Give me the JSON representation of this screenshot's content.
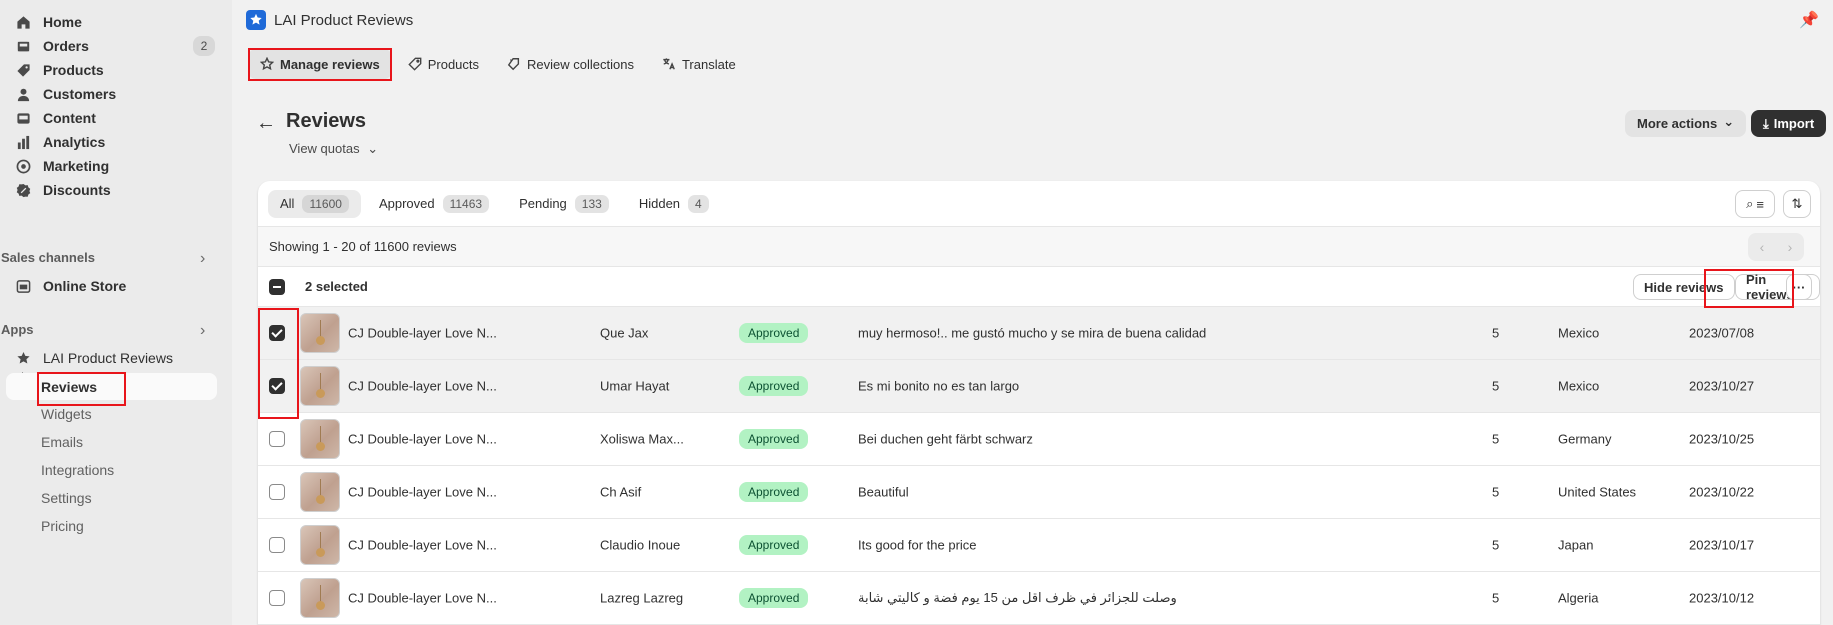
{
  "sidebar": {
    "nav": [
      {
        "label": "Home",
        "icon": "home-icon"
      },
      {
        "label": "Orders",
        "icon": "orders-icon",
        "badge": "2"
      },
      {
        "label": "Products",
        "icon": "tag-icon"
      },
      {
        "label": "Customers",
        "icon": "person-icon"
      },
      {
        "label": "Content",
        "icon": "content-icon"
      },
      {
        "label": "Analytics",
        "icon": "analytics-icon"
      },
      {
        "label": "Marketing",
        "icon": "target-icon"
      },
      {
        "label": "Discounts",
        "icon": "discount-icon"
      }
    ],
    "sales_channels_label": "Sales channels",
    "online_store_label": "Online Store",
    "apps_label": "Apps",
    "app_name": "LAI Product Reviews",
    "app_subitems": [
      "Reviews",
      "Widgets",
      "Emails",
      "Integrations",
      "Settings",
      "Pricing"
    ]
  },
  "topbar": {
    "title": "LAI Product Reviews"
  },
  "tabs": [
    {
      "label": "Manage reviews",
      "icon": "star-icon"
    },
    {
      "label": "Products",
      "icon": "tag-icon"
    },
    {
      "label": "Review collections",
      "icon": "collection-icon"
    },
    {
      "label": "Translate",
      "icon": "translate-icon"
    }
  ],
  "page": {
    "title": "Reviews",
    "view_quotas": "View quotas",
    "more_actions": "More actions",
    "import": "Import"
  },
  "filters": [
    {
      "label": "All",
      "count": "11600"
    },
    {
      "label": "Approved",
      "count": "11463"
    },
    {
      "label": "Pending",
      "count": "133"
    },
    {
      "label": "Hidden",
      "count": "4"
    }
  ],
  "showing": "Showing 1 - 20 of 11600 reviews",
  "bulk": {
    "selected": "2 selected",
    "hide": "Hide reviews",
    "pin": "Pin reviews"
  },
  "rows": [
    {
      "product": "CJ Double-layer Love N...",
      "author": "Que Jax",
      "status": "Approved",
      "content": "muy hermoso!.. me gustó mucho y se mira de buena calidad",
      "rating": "5",
      "country": "Mexico",
      "date": "2023/07/08",
      "checked": true
    },
    {
      "product": "CJ Double-layer Love N...",
      "author": "Umar Hayat",
      "status": "Approved",
      "content": "Es mi bonito no es tan largo",
      "rating": "5",
      "country": "Mexico",
      "date": "2023/10/27",
      "checked": true
    },
    {
      "product": "CJ Double-layer Love N...",
      "author": "Xoliswa Max...",
      "status": "Approved",
      "content": "Bei duchen geht färbt schwarz",
      "rating": "5",
      "country": "Germany",
      "date": "2023/10/25",
      "checked": false
    },
    {
      "product": "CJ Double-layer Love N...",
      "author": "Ch Asif",
      "status": "Approved",
      "content": "Beautiful",
      "rating": "5",
      "country": "United States",
      "date": "2023/10/22",
      "checked": false
    },
    {
      "product": "CJ Double-layer Love N...",
      "author": "Claudio Inoue",
      "status": "Approved",
      "content": "Its good for the price",
      "rating": "5",
      "country": "Japan",
      "date": "2023/10/17",
      "checked": false
    },
    {
      "product": "CJ Double-layer Love N...",
      "author": "Lazreg Lazreg",
      "status": "Approved",
      "content": "وصلت للجزائر في ظرف اقل من 15 يوم فضة و كاليتي شابة",
      "rating": "5",
      "country": "Algeria",
      "date": "2023/10/12",
      "checked": false
    }
  ],
  "colors": {
    "highlight": "#e8151b",
    "approved_bg": "#b2f2c3",
    "approved_text": "#0c5132",
    "primary": "#303030",
    "app_logo": "#1f6ad8"
  }
}
